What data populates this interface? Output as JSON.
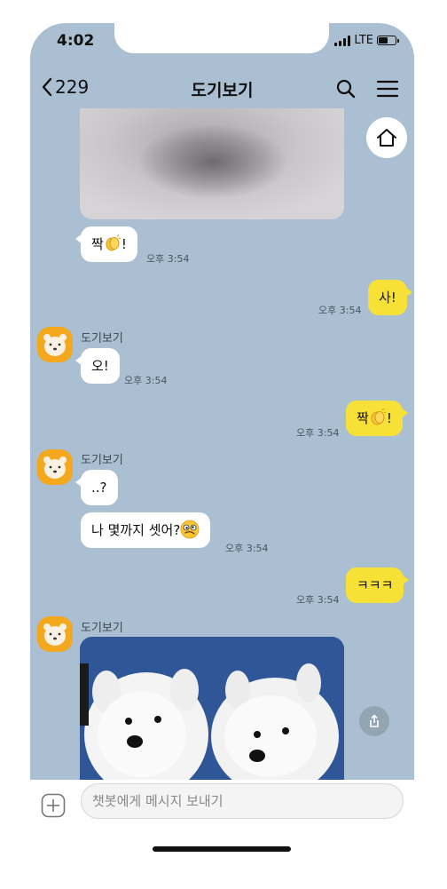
{
  "status_bar": {
    "time": "4:02",
    "network": "LTE"
  },
  "header": {
    "back_count": "229",
    "title": "도기보기",
    "icons": [
      "chevron-left-icon",
      "search-icon",
      "menu-icon"
    ]
  },
  "floating": {
    "home_icon": "home-icon",
    "share_icon": "share-icon"
  },
  "messages": [
    {
      "type": "image",
      "from": "bot",
      "desc_icon": "photo"
    },
    {
      "from": "bot",
      "text": "짝",
      "suffix": "!",
      "emoji": "clapping-hands",
      "time": "오후 3:54"
    },
    {
      "from": "me",
      "text": "사!",
      "time": "오후 3:54"
    },
    {
      "from": "bot",
      "sender": "도기보기",
      "text": "오!",
      "time": "오후 3:54"
    },
    {
      "from": "me",
      "text": "짝",
      "suffix": "!",
      "emoji": "clapping-hands",
      "time": "오후 3:54"
    },
    {
      "from": "bot",
      "sender": "도기보기",
      "text": "..?"
    },
    {
      "from": "bot",
      "text": "나 몇까지 셋어?",
      "emoji": "woozy-face",
      "time": "오후 3:54"
    },
    {
      "from": "me",
      "text": "ㅋㅋㅋ",
      "time": "오후 3:54"
    },
    {
      "from": "bot",
      "sender": "도기보기",
      "type": "image"
    }
  ],
  "input": {
    "placeholder": "챗봇에게 메시지 보내기"
  },
  "colors": {
    "chat_background": "#aabfd1",
    "my_bubble": "#f8e136",
    "bot_bubble": "#ffffff",
    "avatar": "#f3a81e"
  }
}
